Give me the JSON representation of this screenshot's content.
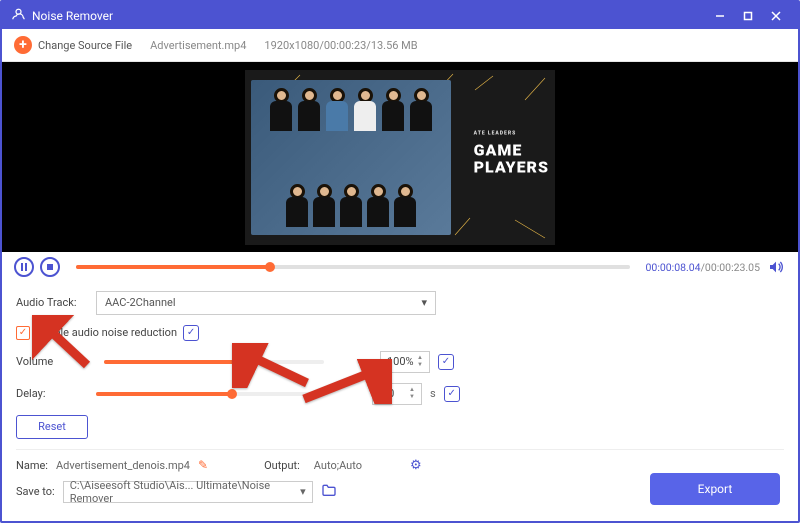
{
  "titlebar": {
    "title": "Noise Remover"
  },
  "toolbar": {
    "change_source": "Change Source File",
    "filename": "Advertisement.mp4",
    "fileinfo": "1920x1080/00:00:23/13.56 MB"
  },
  "video": {
    "overlay_sub": "ATE LEADERS",
    "overlay_title_1": "GAME",
    "overlay_title_2": "PLAYERS"
  },
  "transport": {
    "progress_pct": 35,
    "time_current": "00:00:08.04",
    "time_total": "/00:00:23.05"
  },
  "controls": {
    "audio_track_label": "Audio Track:",
    "audio_track_value": "AAC-2Channel",
    "enable_noise_label": "Enable audio noise reduction",
    "volume_label": "Volume:",
    "volume_value": "100%",
    "volume_pct": 62,
    "delay_label": "Delay:",
    "delay_value": "0.0",
    "delay_pct": 62,
    "delay_unit": "s",
    "reset_label": "Reset"
  },
  "footer": {
    "name_label": "Name:",
    "name_value": "Advertisement_denois.mp4",
    "output_label": "Output:",
    "output_value": "Auto;Auto",
    "save_label": "Save to:",
    "save_value": "C:\\Aiseesoft Studio\\Ais... Ultimate\\Noise Remover",
    "export_label": "Export"
  },
  "chk_mark": "✓"
}
